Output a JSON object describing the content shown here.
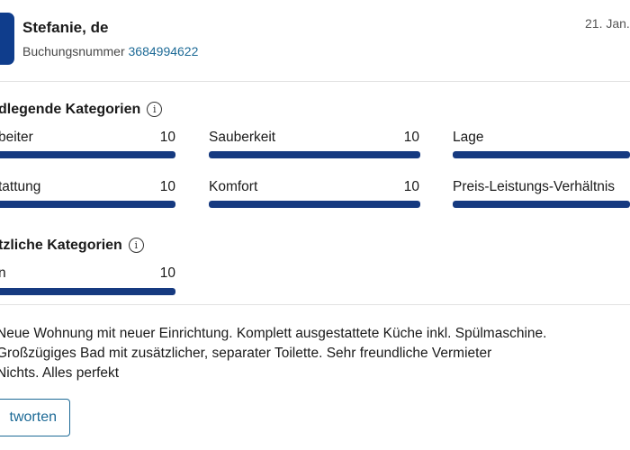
{
  "header": {
    "guest_name": "Stefanie, de",
    "booking_label": "Buchungsnummer",
    "booking_number": "3684994622",
    "date": "21. Jan."
  },
  "basic_categories": {
    "title": "dlegende Kategorien",
    "info_icon": "info-icon",
    "items": [
      {
        "label": "beiter",
        "score": "10",
        "fill": 1.0
      },
      {
        "label": "Sauberkeit",
        "score": "10",
        "fill": 1.0
      },
      {
        "label": "Lage",
        "score": "",
        "fill": 1.0
      },
      {
        "label": "tattung",
        "score": "10",
        "fill": 1.0
      },
      {
        "label": "Komfort",
        "score": "10",
        "fill": 1.0
      },
      {
        "label": "Preis-Leistungs-Verhältnis",
        "score": "",
        "fill": 1.0
      }
    ]
  },
  "extra_categories": {
    "title": "tzliche Kategorien",
    "info_icon": "info-icon",
    "items": [
      {
        "label": "n",
        "score": "10",
        "fill": 1.0
      }
    ]
  },
  "review": {
    "lines": [
      "Neue Wohnung mit neuer Einrichtung. Komplett ausgestattete Küche inkl. Spülmaschine.",
      "Großzügiges Bad mit zusätzlicher, separater Toilette. Sehr freundliche Vermieter",
      "Nichts. Alles perfekt"
    ]
  },
  "actions": {
    "reply_label": "tworten"
  },
  "colors": {
    "bar_fill": "#163a80",
    "link": "#1d6a96",
    "avatar": "#0f3d8c"
  }
}
